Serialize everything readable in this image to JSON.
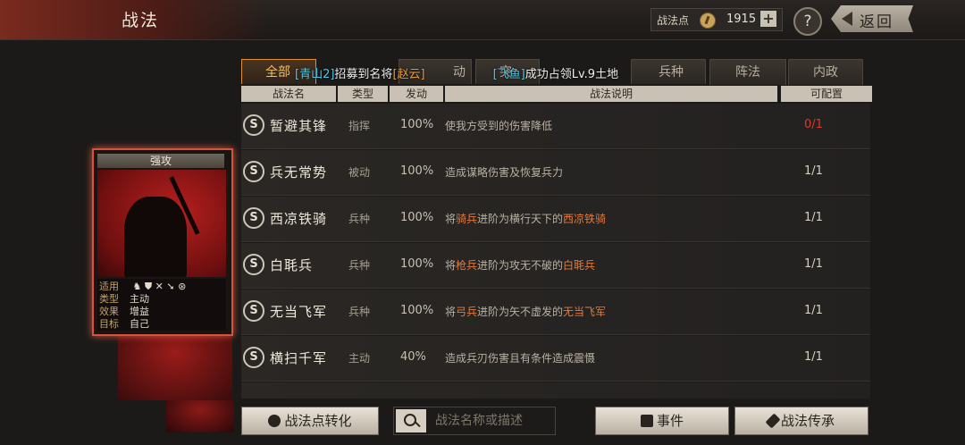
{
  "header": {
    "title": "战法"
  },
  "points": {
    "label": "战法点",
    "value": "1915",
    "plus": "+"
  },
  "help": {
    "label": "?"
  },
  "back": {
    "label": "返回"
  },
  "card": {
    "title": "强攻",
    "info": [
      {
        "key": "适用",
        "value": ""
      },
      {
        "key": "类型",
        "value": "主动"
      },
      {
        "key": "效果",
        "value": "增益"
      },
      {
        "key": "目标",
        "value": "自己"
      }
    ],
    "applies_icons": [
      "cavalry-icon",
      "shield-icon",
      "bow-icon",
      "spear-icon",
      "wheel-icon"
    ]
  },
  "tabs": [
    {
      "label": "全部"
    },
    {
      "label": "动"
    },
    {
      "label": "突"
    },
    {
      "label": "兵种"
    },
    {
      "label": "阵法"
    },
    {
      "label": "内政"
    }
  ],
  "notice": {
    "p1": "[青山2]",
    "p2": "招募到名将",
    "p3": "[赵云]",
    "p4": "[飞鱼]",
    "p5": "成功占领Lv.9土地"
  },
  "columns": [
    "战法名",
    "类型",
    "发动",
    "战法说明",
    "可配置"
  ],
  "rows": [
    {
      "grade": "S",
      "name": "暂避其锋",
      "type": "指挥",
      "rate": "100%",
      "desc": [
        "使我方受到的伤害降低"
      ],
      "config": "0/1",
      "config_red": true
    },
    {
      "grade": "S",
      "name": "兵无常势",
      "type": "被动",
      "rate": "100%",
      "desc": [
        "造成谋略伤害及恢复兵力"
      ],
      "config": "1/1"
    },
    {
      "grade": "S",
      "name": "西凉铁骑",
      "type": "兵种",
      "rate": "100%",
      "desc": [
        "将",
        "骑兵",
        "进阶为横行天下的",
        "西凉铁骑"
      ],
      "config": "1/1"
    },
    {
      "grade": "S",
      "name": "白毦兵",
      "type": "兵种",
      "rate": "100%",
      "desc": [
        "将",
        "枪兵",
        "进阶为攻无不破的",
        "白毦兵"
      ],
      "config": "1/1"
    },
    {
      "grade": "S",
      "name": "无当飞军",
      "type": "兵种",
      "rate": "100%",
      "desc": [
        "将",
        "弓兵",
        "进阶为矢不虚发的",
        "无当飞军"
      ],
      "config": "1/1"
    },
    {
      "grade": "S",
      "name": "横扫千军",
      "type": "主动",
      "rate": "40%",
      "desc": [
        "造成兵刃伤害且有条件造成震慑"
      ],
      "config": "1/1"
    }
  ],
  "bottom": {
    "convert": "战法点转化",
    "search_placeholder": "战法名称或描述",
    "events": "事件",
    "inherit": "战法传承"
  }
}
